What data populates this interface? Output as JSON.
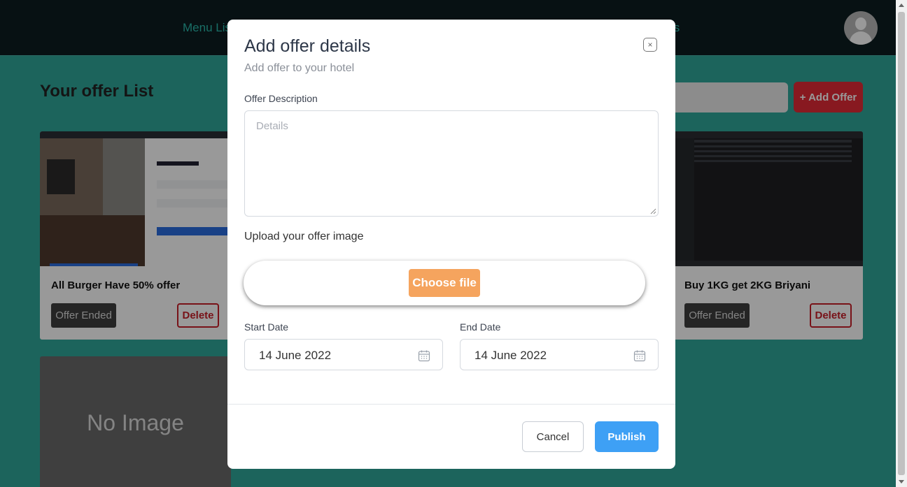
{
  "header": {
    "nav_left": "Menu Lis",
    "nav_right": "ts"
  },
  "page": {
    "title": "Your offer List",
    "add_offer_label": "+ Add Offer"
  },
  "cards": [
    {
      "title": "All Burger Have 50% offer",
      "status": "Offer Ended",
      "delete_label": "Delete"
    },
    {
      "title": "Buy 1KG get 2KG Briyani",
      "status": "Offer Ended",
      "delete_label": "Delete"
    },
    {
      "placeholder": "No Image"
    }
  ],
  "modal": {
    "title": "Add offer details",
    "subtitle": "Add offer to your hotel",
    "close_glyph": "×",
    "description_label": "Offer Description",
    "description_placeholder": "Details",
    "upload_label": "Upload your offer image",
    "choose_file_label": "Choose file",
    "start_date_label": "Start Date",
    "start_date_value": "14 June 2022",
    "end_date_label": "End Date",
    "end_date_value": "14 June 2022",
    "cancel_label": "Cancel",
    "publish_label": "Publish"
  },
  "colors": {
    "background": "#2fa79a",
    "topbar": "#0d1d21",
    "accent_red": "#e32b36",
    "choose_file": "#f5a45e",
    "publish": "#3ea0f5"
  }
}
